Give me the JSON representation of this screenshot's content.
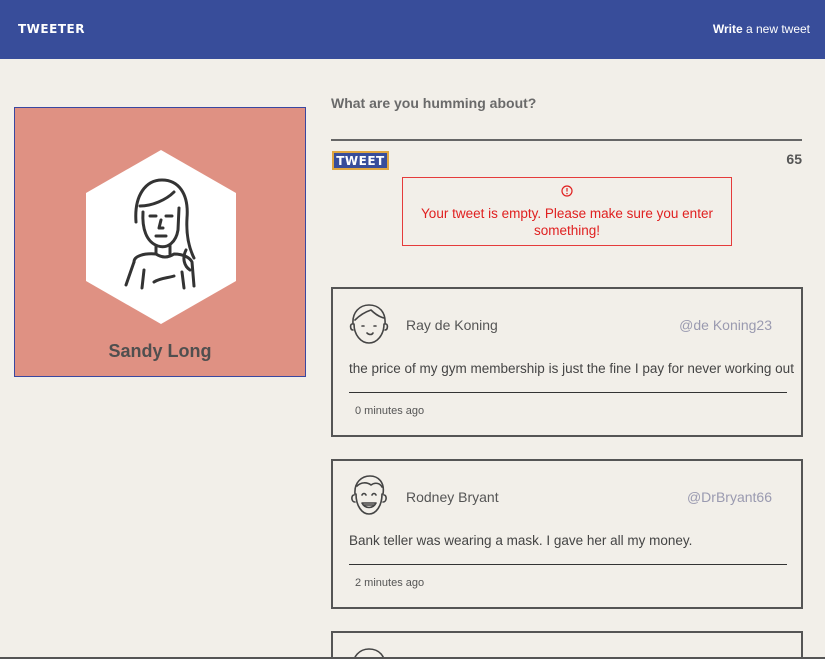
{
  "nav": {
    "brand": "TWEETER",
    "write_strong": "Write",
    "write_rest": " a new tweet"
  },
  "profile": {
    "name": "Sandy Long"
  },
  "compose": {
    "label": "What are you humming about?",
    "value": "",
    "button_label": "TWEET",
    "counter": "65",
    "error": "Your tweet is empty. Please make sure you enter something!"
  },
  "tweets": [
    {
      "name": "Ray de Koning",
      "handle": "@de Koning23",
      "text": "the price of my gym membership is just the fine I pay for never working out",
      "time": "0 minutes ago",
      "avatar_icon": "boy-avatar-icon"
    },
    {
      "name": "Rodney Bryant",
      "handle": "@DrBryant66",
      "text": "Bank teller was wearing a mask. I gave her all my money.",
      "time": "2 minutes ago",
      "avatar_icon": "smiling-man-avatar-icon"
    }
  ],
  "colors": {
    "navbar": "#384d9a",
    "background": "#f2efe9",
    "profile_bg": "#df9183",
    "error": "#e02020",
    "button_border": "#e0a640"
  }
}
